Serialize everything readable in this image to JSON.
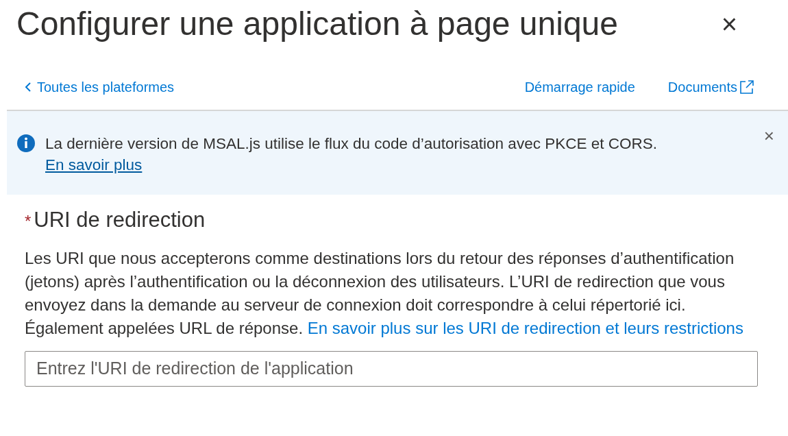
{
  "panel": {
    "title": "Configurer une application à page unique",
    "close": "×"
  },
  "nav": {
    "back": "Toutes les plateformes",
    "links": [
      {
        "label": "Démarrage rapide",
        "external": false
      },
      {
        "label": "Documents",
        "external": true
      }
    ]
  },
  "banner": {
    "message": "La dernière version de MSAL.js utilise le flux du code d’autorisation avec PKCE et CORS.",
    "link": "En savoir plus",
    "close": "×"
  },
  "field": {
    "label": "URI de redirection",
    "required": true,
    "required_mark": "*",
    "description": "Les URI que nous accepterons comme destinations lors du retour des réponses d’authentification (jetons) après l’authentification ou la déconnexion des utilisateurs. L’URI de redirection que vous envoyez dans la demande au serveur de connexion doit correspondre à celui répertorié ici. Également appelées URL de réponse.",
    "link": "En savoir plus sur les URI de redirection et leurs restrictions",
    "placeholder": "Entrez l'URI de redirection de l'application"
  }
}
